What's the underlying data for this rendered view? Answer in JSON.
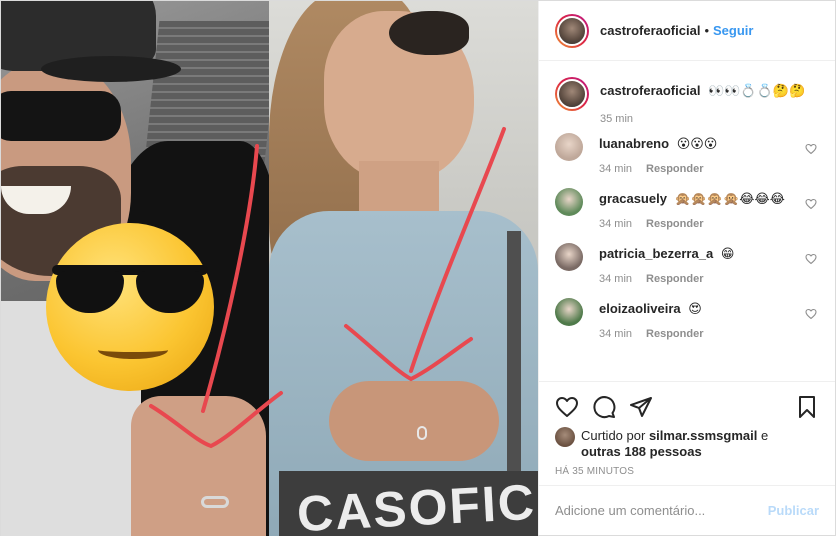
{
  "post": {
    "username": "castroferaoficial",
    "dot": "•",
    "follow_label": "Seguir"
  },
  "caption": {
    "username": "castroferaoficial",
    "text": "👀👀💍💍🤔🤔",
    "time": "35 min"
  },
  "comments": [
    {
      "username": "luanabreno",
      "text": "😮😮😮",
      "time": "34 min",
      "reply_label": "Responder",
      "avatar_color": "#bfa89a"
    },
    {
      "username": "gracasuely",
      "text": "🙊🙊🙊🙊😂😂😂",
      "time": "34 min",
      "reply_label": "Responder",
      "avatar_color": "#5f8a5a"
    },
    {
      "username": "patricia_bezerra_a",
      "text": "😁",
      "time": "34 min",
      "reply_label": "Responder",
      "avatar_color": "#7a6a64"
    },
    {
      "username": "eloizaoliveira",
      "text": "😍",
      "time": "34 min",
      "reply_label": "Responder",
      "avatar_color": "#4f7a4a"
    }
  ],
  "likes": {
    "prefix": "Curtido por",
    "user": "silmar.ssmsgmail",
    "conjunction": "e",
    "others": "outras 188 pessoas"
  },
  "timestamp": "HÁ 35 MINUTOS",
  "comment_box": {
    "placeholder": "Adicione um comentário...",
    "publish_label": "Publicar"
  },
  "media": {
    "bag_text": "CASOFIC"
  },
  "icons": {
    "like": "heart-icon",
    "comment": "comment-icon",
    "share": "share-icon",
    "save": "bookmark-icon"
  },
  "colors": {
    "accent": "#3897f0",
    "arrow": "#e8484f"
  }
}
